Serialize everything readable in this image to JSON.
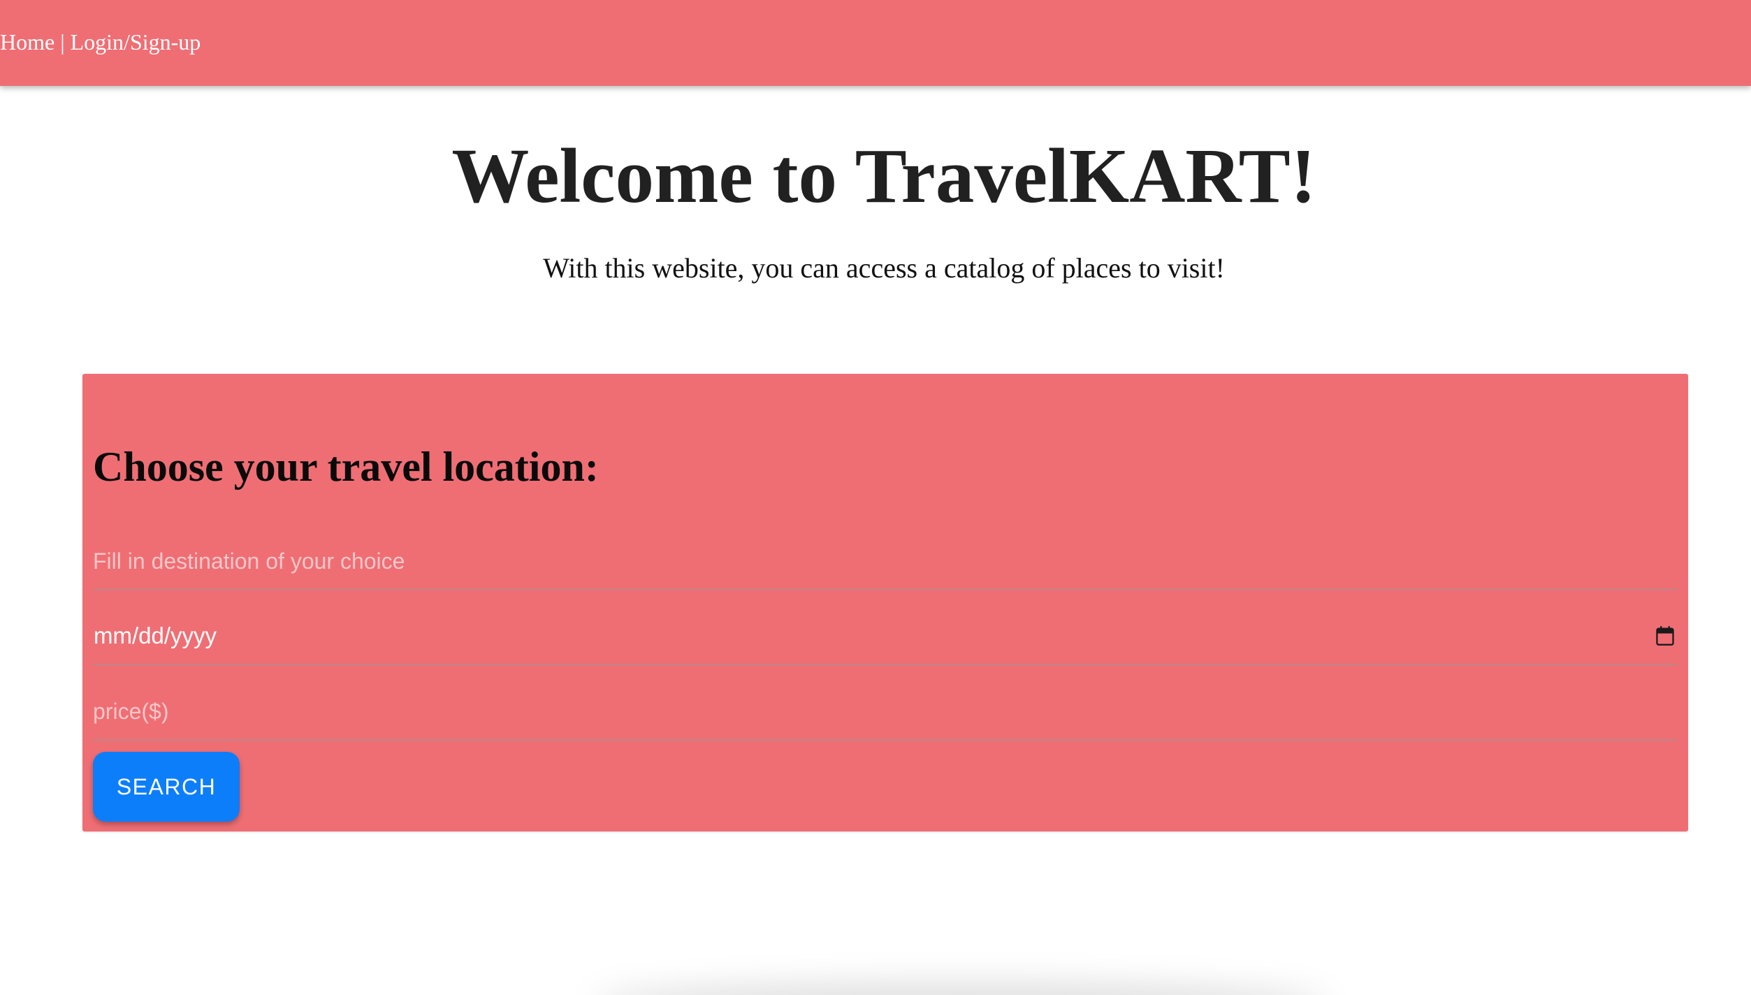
{
  "nav": {
    "home_label": "Home",
    "separator": " | ",
    "login_label": "Login/Sign-up"
  },
  "hero": {
    "title": "Welcome to TravelKART!",
    "subtitle": "With this website, you can access a catalog of places to visit!"
  },
  "search_form": {
    "heading": "Choose your travel location:",
    "destination_placeholder": "Fill in destination of your choice",
    "date_value": "mm/dd/yyyy",
    "date_icon": "calendar-icon",
    "price_placeholder": "price($)",
    "search_label": "SEARCH"
  },
  "colors": {
    "header_background": "#ef6e74",
    "panel_background": "#ef6e74",
    "search_button": "#0d7ef9",
    "title_text": "#212121"
  }
}
